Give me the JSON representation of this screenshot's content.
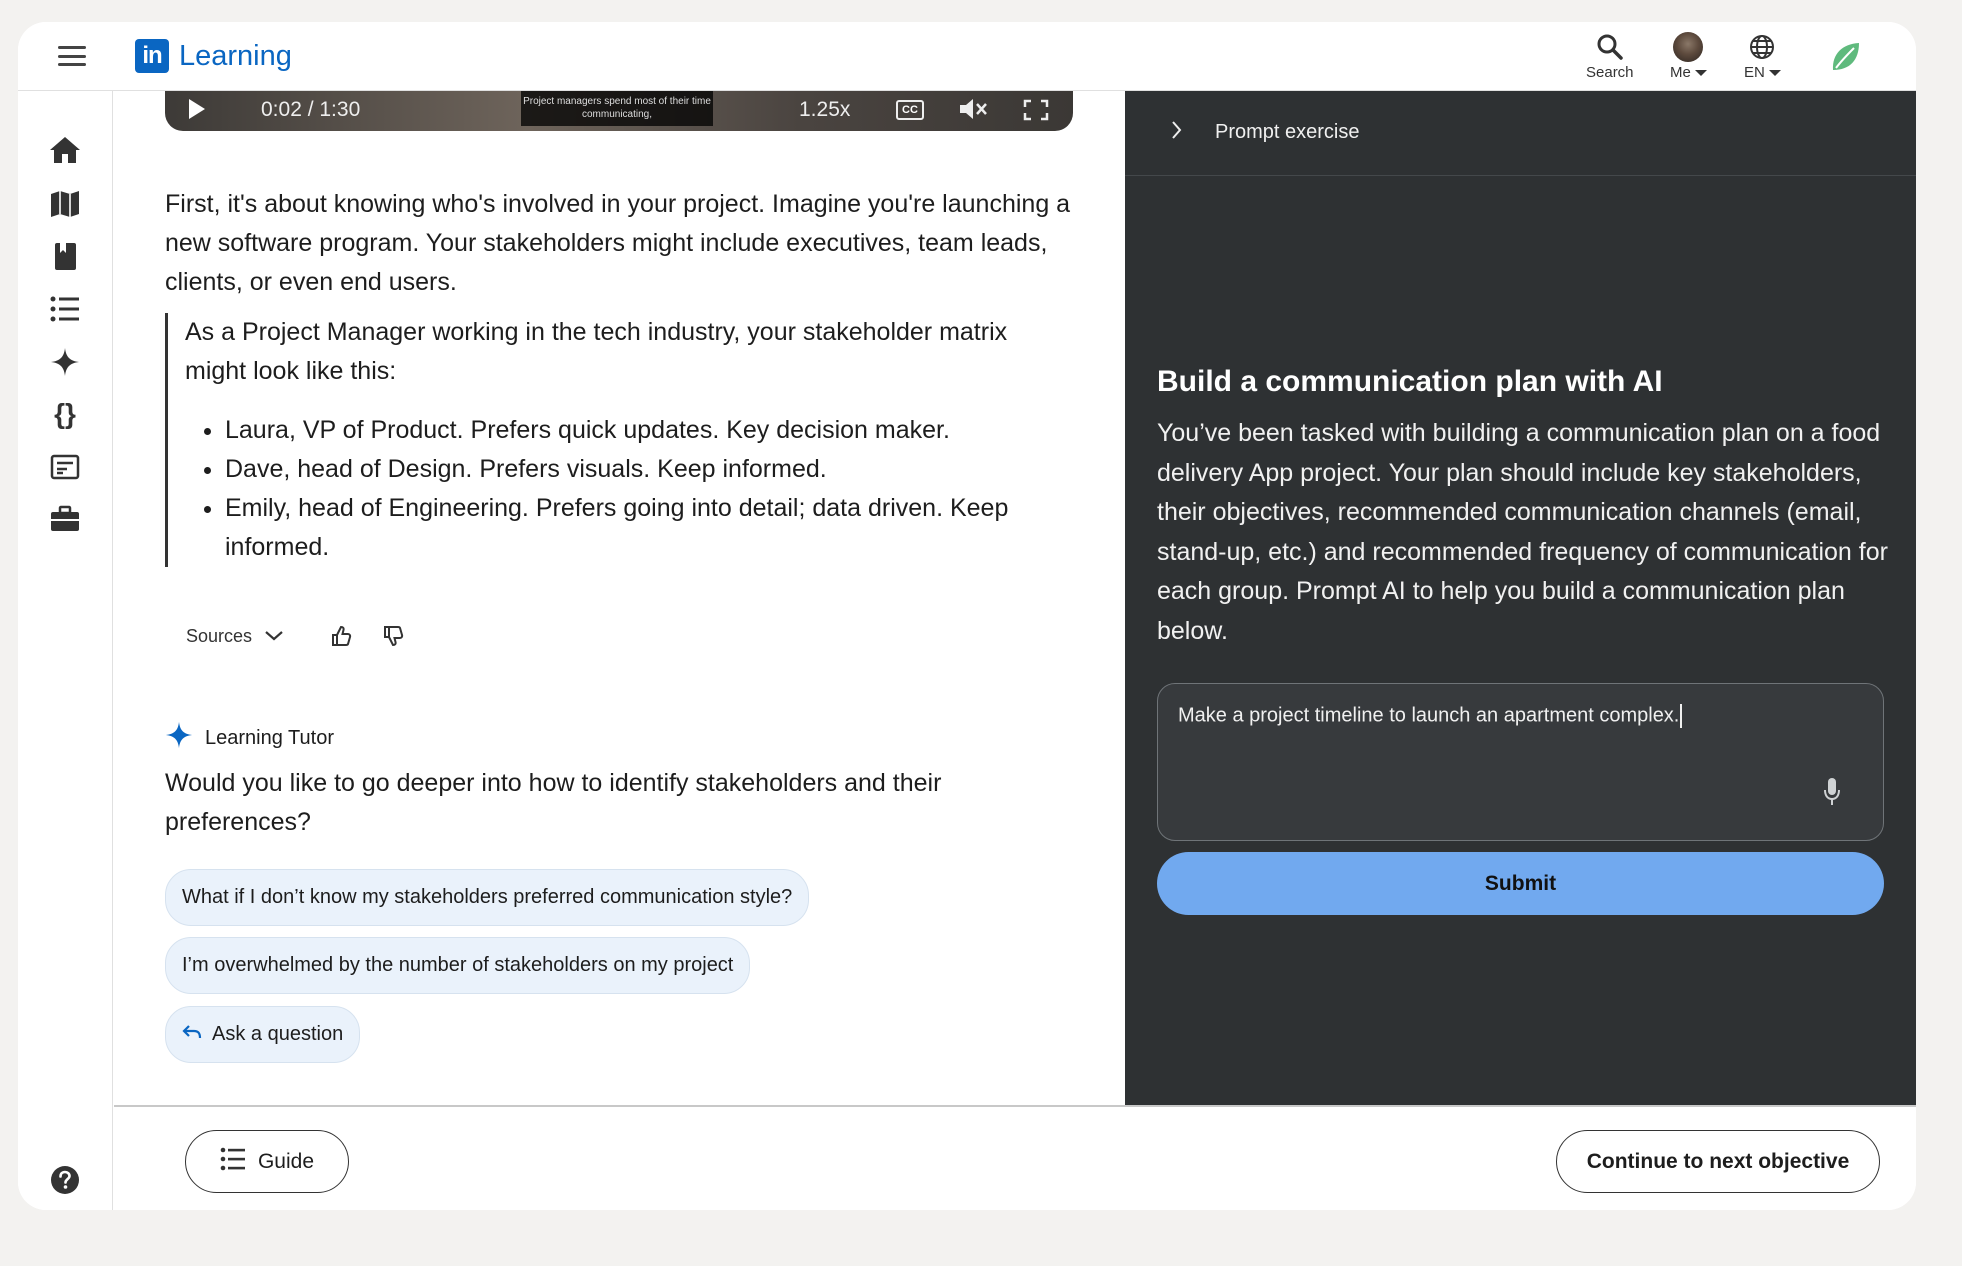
{
  "topbar": {
    "logo_mark": "in",
    "logo_text": "Learning",
    "search_label": "Search",
    "me_label": "Me",
    "lang_label": "EN"
  },
  "rail": {
    "icons": [
      "home-icon",
      "map-icon",
      "book-icon",
      "list-icon",
      "sparkle-icon",
      "braces-icon",
      "certificate-icon",
      "briefcase-icon"
    ],
    "help_icon": "help-icon"
  },
  "video": {
    "time": "0:02 / 1:30",
    "caption": "Project managers spend most of their time communicating,",
    "speed": "1.25x",
    "cc": "CC"
  },
  "main": {
    "intro": "First, it's about knowing who's involved in your project. Imagine you're launching a new software program. Your stakeholders might include executives, team leads, clients, or even end users.",
    "quote_intro": "As a Project Manager working in the tech industry, your stakeholder matrix might look like this:",
    "quote_items": [
      "Laura, VP of Product. Prefers quick updates. Key decision maker.",
      "Dave, head of Design. Prefers visuals. Keep informed.",
      "Emily, head of Engineering. Prefers going into detail; data driven. Keep informed."
    ],
    "sources_label": "Sources",
    "tutor_label": "Learning Tutor",
    "tutor_question": "Would you like to go deeper into how to identify stakeholders and their preferences?",
    "chips": [
      "What if I don’t know my stakeholders preferred communication style?",
      "I’m overwhelmed by the number of stakeholders on my project",
      "Ask a question"
    ]
  },
  "panel": {
    "header_title": "Prompt exercise",
    "heading": "Build a communication plan with AI",
    "description": "You’ve been tasked with building a communication plan on a food delivery App project. Your plan should include key stakeholders, their objectives, recommended communication channels (email, stand-up, etc.) and recommended frequency of communication for each group. Prompt AI to help you build a communication plan below.",
    "prompt_value": "Make a project timeline to launch an apartment complex.",
    "submit_label": "Submit"
  },
  "footer": {
    "guide_label": "Guide",
    "continue_label": "Continue to next objective"
  },
  "colors": {
    "brand": "#0a66c2",
    "panel_bg": "#2e3133",
    "submit_bg": "#71a9ef",
    "chip_bg": "#eaf2fb"
  }
}
